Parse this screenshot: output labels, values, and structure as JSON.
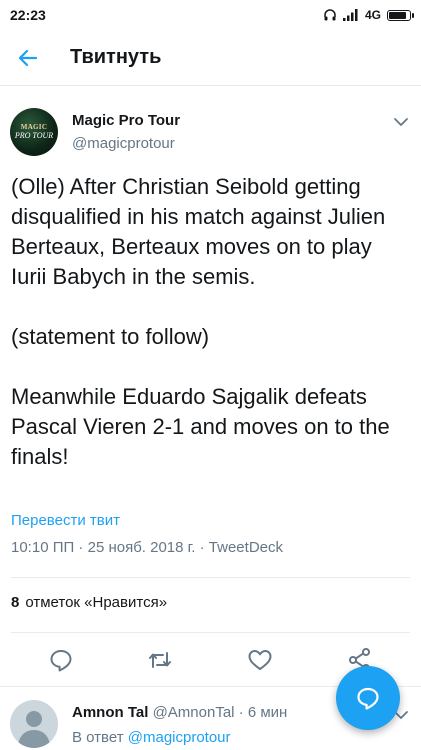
{
  "status_bar": {
    "time": "22:23",
    "network": "4G",
    "battery_level": 0.85
  },
  "header": {
    "title": "Твитнуть",
    "back_icon": "arrow-left-icon"
  },
  "tweet": {
    "author_name": "Magic Pro Tour",
    "author_handle": "@magicprotour",
    "avatar_logo_text": [
      "MAGIC",
      "PRO TOUR"
    ],
    "text": "(Olle) After Christian Seibold getting disqualified in his match against Julien Berteaux, Berteaux  moves on to play Iurii Babych in the semis.\n\n(statement to follow)\n\nMeanwhile Eduardo Sajgalik defeats Pascal Vieren 2-1 and moves on to the finals!",
    "translate_label": "Перевести твит",
    "meta": "10:10 ПП · 25 нояб. 2018 г. · TweetDeck",
    "likes_count": "8",
    "likes_label": "отметок «Нравится»"
  },
  "actions": [
    {
      "name": "reply",
      "icon": "comment-icon"
    },
    {
      "name": "retweet",
      "icon": "retweet-icon"
    },
    {
      "name": "like",
      "icon": "heart-icon"
    },
    {
      "name": "share",
      "icon": "share-icon"
    }
  ],
  "reply": {
    "name": "Amnon Tal",
    "handle_time": "@AmnonTal · 6 мин",
    "reply_to_prefix": "В ответ",
    "reply_to_handle": "@magicprotour"
  },
  "colors": {
    "accent": "#1da1f2",
    "text": "#14171a",
    "secondary": "#657786",
    "divider": "#e6ecf0"
  }
}
